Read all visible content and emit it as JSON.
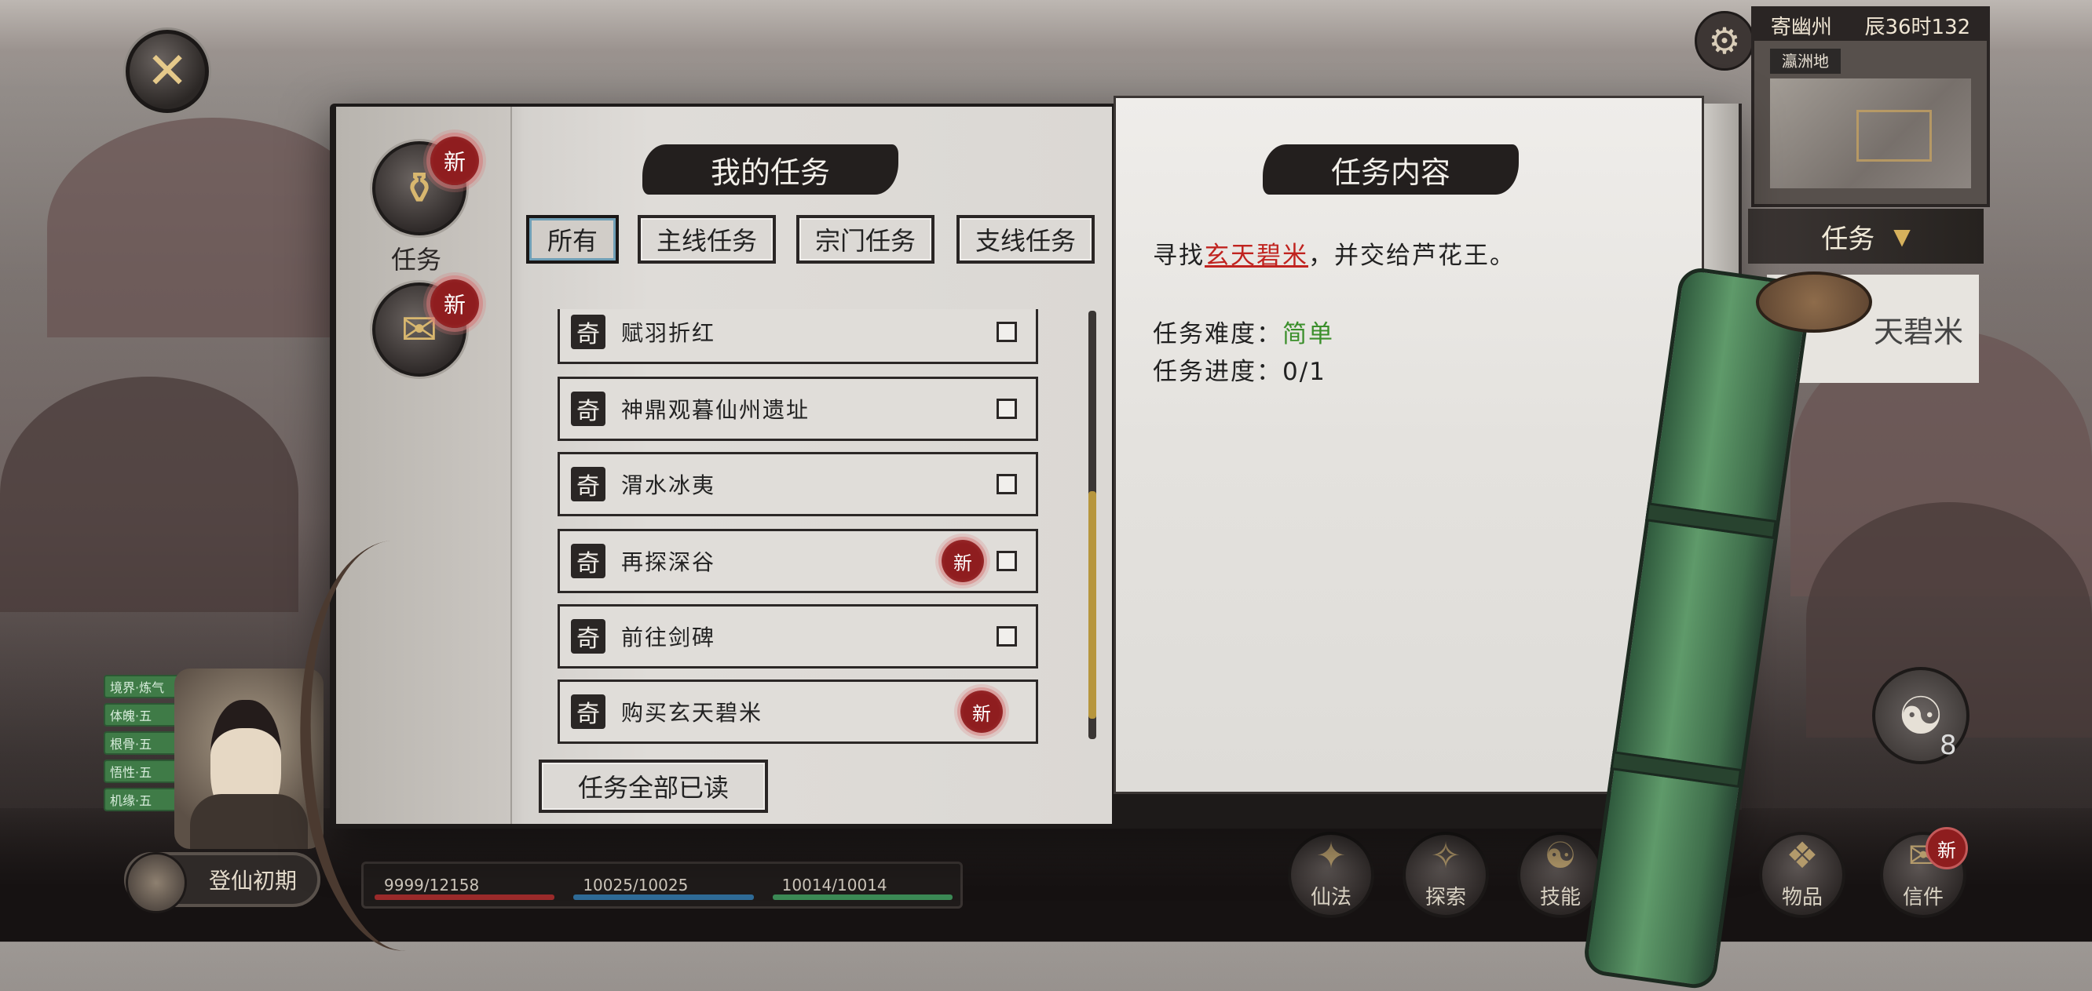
{
  "hud": {
    "minimap_top_left": "寄幽州",
    "minimap_time": "辰36时132",
    "minimap_tag": "瀛洲地",
    "task_tab_label": "任务",
    "task_preview_text": "天碧米",
    "yin_yang_count": "8",
    "login_label": "登仙初期",
    "stats": {
      "hp": "9999/12158",
      "mp": "10025/10025",
      "sp": "10014/10014"
    },
    "bottom_buttons": [
      "仙法",
      "探索",
      "技能",
      "物品",
      "信件"
    ],
    "buffs": [
      "境界·炼气",
      "体魄·五",
      "根骨·五",
      "悟性·五",
      "机缘·五"
    ]
  },
  "sidebar": {
    "categories": [
      {
        "label": "任务",
        "badge": "新"
      },
      {
        "label": "",
        "badge": "新"
      }
    ]
  },
  "left_page": {
    "title": "我的任务",
    "filter_tabs": [
      "所有",
      "主线任务",
      "宗门任务",
      "支线任务"
    ],
    "active_tab": "所有",
    "quests": [
      {
        "icon": "奇",
        "name": "赋羽折红",
        "is_new": false
      },
      {
        "icon": "奇",
        "name": "神鼎观暮仙州遗址",
        "is_new": false
      },
      {
        "icon": "奇",
        "name": "渭水冰夷",
        "is_new": false
      },
      {
        "icon": "奇",
        "name": "再探深谷",
        "is_new": true,
        "badge": "新"
      },
      {
        "icon": "奇",
        "name": "前往剑碑",
        "is_new": false
      },
      {
        "icon": "奇",
        "name": "购买玄天碧米",
        "is_new": true,
        "badge": "新"
      }
    ],
    "scroll_position": 0.9,
    "read_all_label": "任务全部已读"
  },
  "right_page": {
    "title": "任务内容",
    "description_prefix": "寻找",
    "description_highlight": "玄天碧米",
    "description_suffix": "，并交给芦花王。",
    "difficulty_label": "任务难度：",
    "difficulty_value": "简单",
    "progress_label": "任务进度：",
    "progress_value": "0/1"
  },
  "colors": {
    "highlight_red": "#c0231f",
    "difficulty_green": "#3b8f2b",
    "badge_red": "#8f1d1f",
    "scroll_gold": "#b7963d"
  }
}
